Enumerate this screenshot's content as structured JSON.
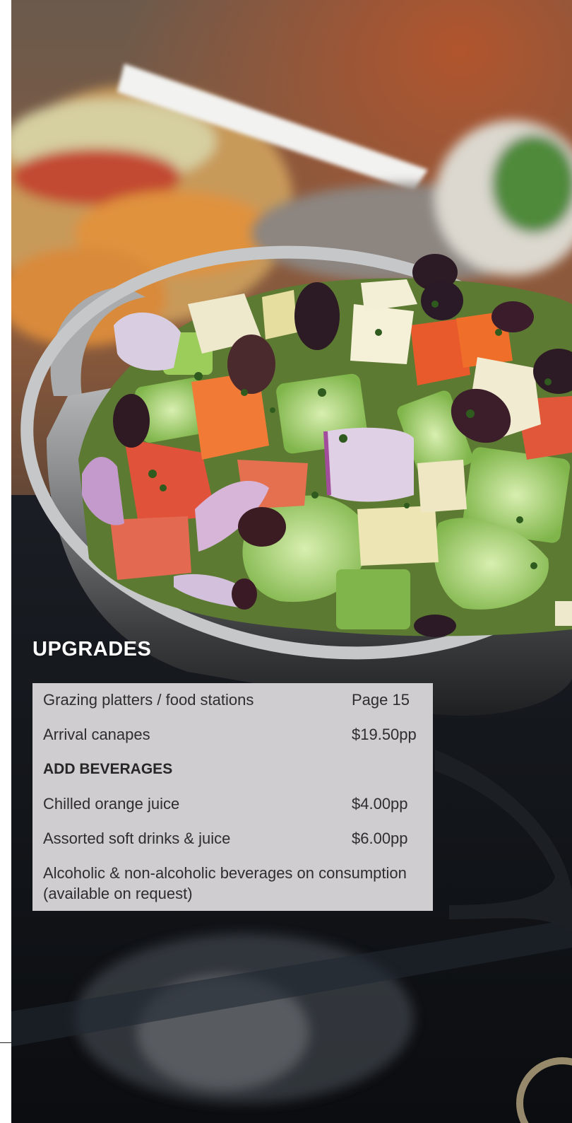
{
  "section": {
    "title": "UPGRADES"
  },
  "upgrades": [
    {
      "label": "Grazing platters / food stations",
      "price": "Page 15"
    },
    {
      "label": "Arrival canapes",
      "price": "$19.50pp"
    }
  ],
  "beverages_heading": "ADD BEVERAGES",
  "beverages": [
    {
      "label": "Chilled orange juice",
      "price": "$4.00pp"
    },
    {
      "label": "Assorted soft drinks & juice",
      "price": "$6.00pp"
    }
  ],
  "note": "Alcoholic & non-alcoholic beverages on consumption (available on request)",
  "colors": {
    "panel_bg": "#cfcdcf",
    "panel_text": "#2e2e2e",
    "title_text": "#ffffff",
    "photo_dark": "#15181c"
  }
}
